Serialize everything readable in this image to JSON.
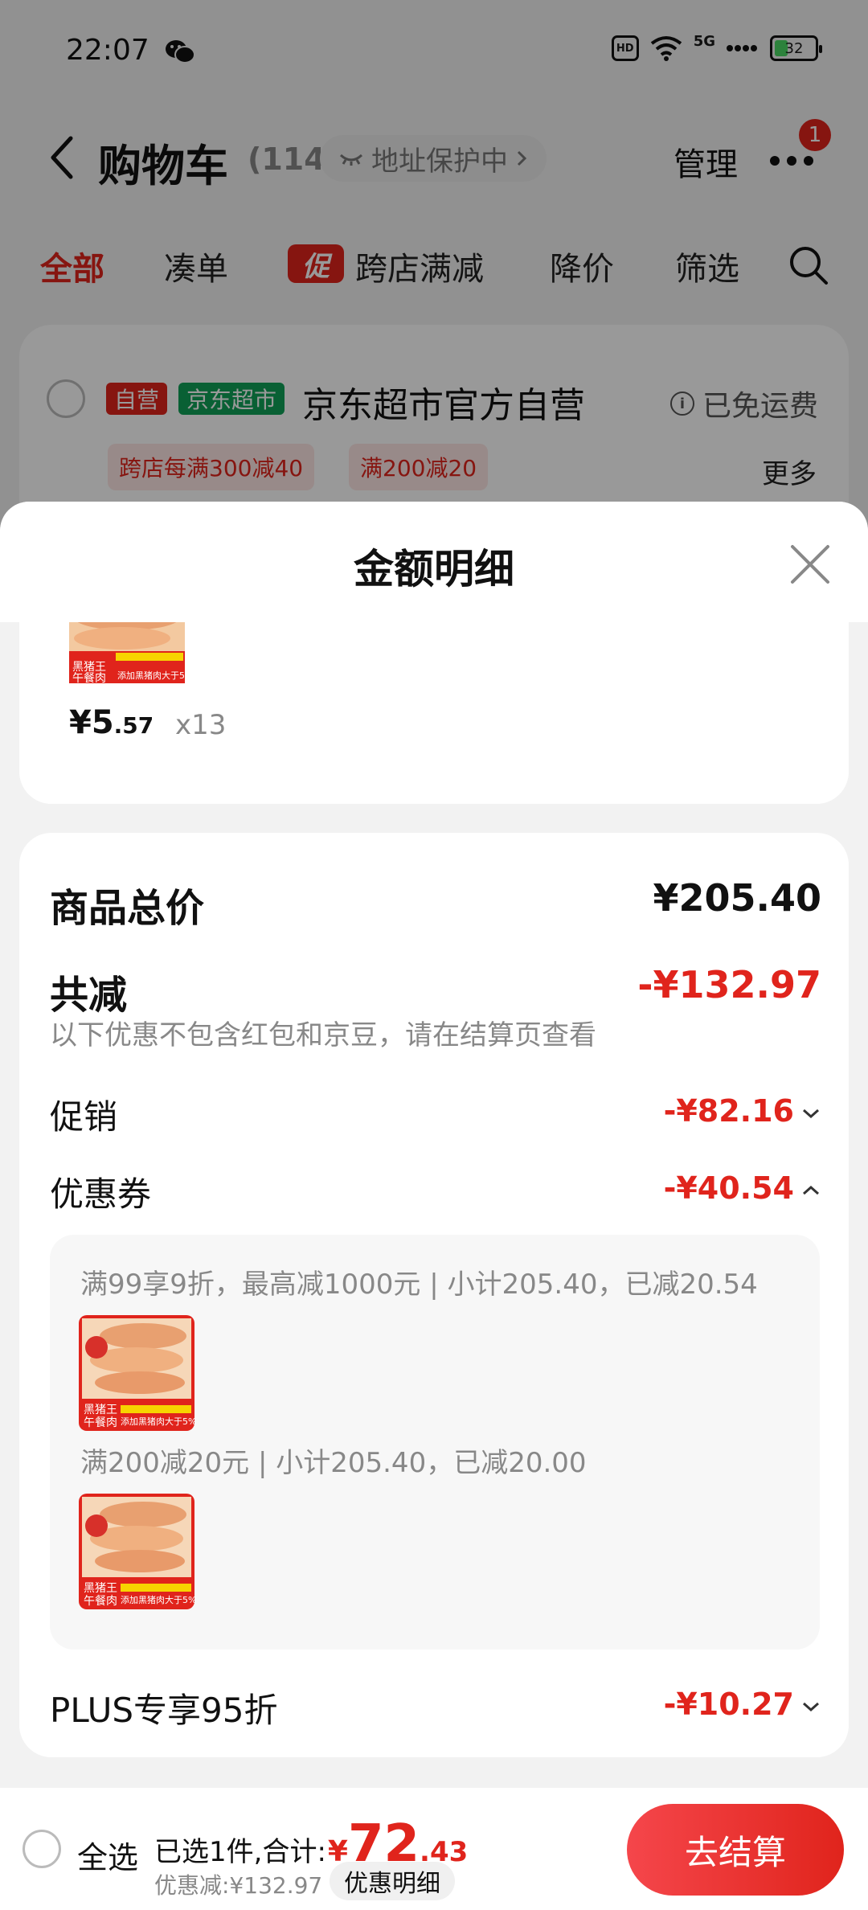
{
  "status_bar": {
    "time": "22:07",
    "hd": "HD",
    "network": "5G",
    "battery": "32"
  },
  "nav": {
    "title": "购物车",
    "count": "(114)",
    "address_protect": "地址保护中",
    "manage": "管理",
    "more_badge": "1"
  },
  "tabs": {
    "all": "全部",
    "bundle": "凑单",
    "promo_tag": "促",
    "cross_store": "跨店满减",
    "price_drop": "降价",
    "filter": "筛选"
  },
  "store": {
    "tag_self": "自营",
    "tag_jd": "京东超市",
    "name": "京东超市官方自营",
    "shipping": "已免运费",
    "coupons": [
      "跨店每满300减40",
      "满200减20"
    ],
    "more": "更多"
  },
  "sheet": {
    "title": "金额明细",
    "product": {
      "price_int": "¥5",
      "price_dec": ".57",
      "qty": "x13",
      "image_text": [
        "黑猪王",
        "午餐肉",
        "添加黑猪肉大于5%"
      ]
    },
    "total_label": "商品总价",
    "total_value": "¥205.40",
    "reduce_label": "共减",
    "reduce_value": "-¥132.97",
    "reduce_note": "以下优惠不包含红包和京豆，请在结算页查看",
    "promo_label": "促销",
    "promo_value": "-¥82.16",
    "coupon_label": "优惠券",
    "coupon_value": "-¥40.54",
    "coupon_details": [
      "满99享9折，最高减1000元 | 小计205.40，已减20.54",
      "满200减20元 | 小计205.40，已减20.00"
    ],
    "plus_label": "PLUS专享95折",
    "plus_value": "-¥10.27"
  },
  "bottom": {
    "select_all": "全选",
    "selected_prefix": "已选1件,合计:",
    "currency": "¥",
    "amount_int": "72",
    "amount_dec": ".43",
    "discount": "优惠减:¥132.97",
    "detail_button": "优惠明细",
    "checkout": "去结算"
  },
  "colors": {
    "accent_red": "#e0241c",
    "jd_green": "#0fa158",
    "muted_text": "#888888"
  }
}
